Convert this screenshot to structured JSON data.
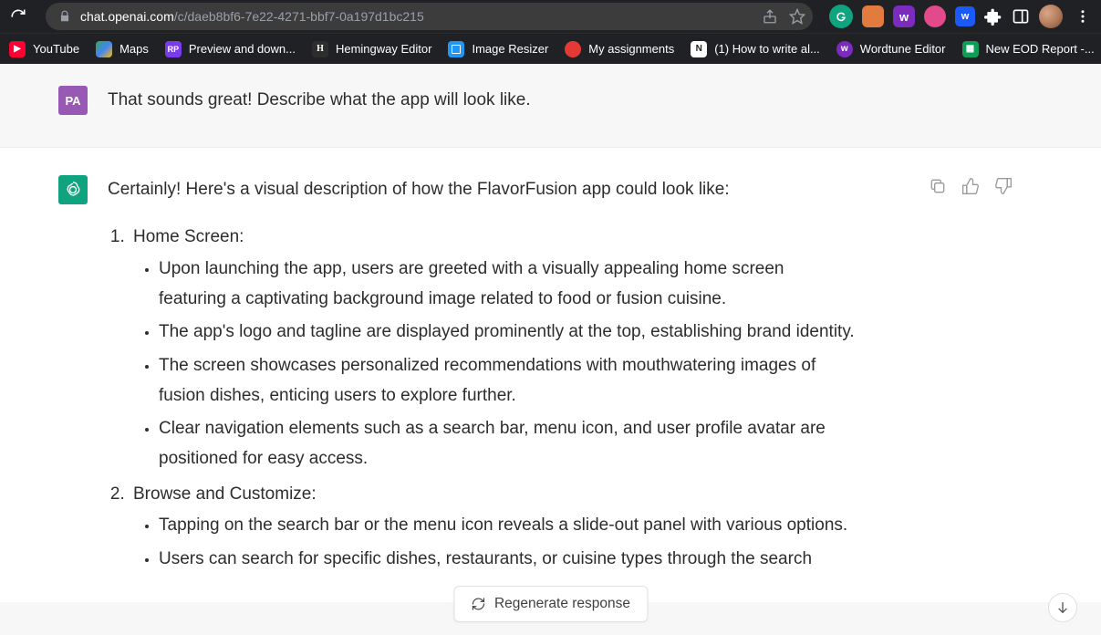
{
  "browser": {
    "url_host": "chat.openai.com",
    "url_path": "/c/daeb8bf6-7e22-4271-bbf7-0a197d1bc215"
  },
  "extensions": {
    "g": "",
    "w1": "w",
    "w2": "w"
  },
  "bookmarks": {
    "items": [
      {
        "label": "YouTube"
      },
      {
        "label": "Maps"
      },
      {
        "label": "Preview and down..."
      },
      {
        "label": "Hemingway Editor"
      },
      {
        "label": "Image Resizer"
      },
      {
        "label": "My assignments"
      },
      {
        "label": "(1) How to write al..."
      },
      {
        "label": "Wordtune Editor"
      },
      {
        "label": "New EOD Report -..."
      }
    ],
    "more": "»"
  },
  "chat": {
    "user_initials": "PA",
    "user_message": "That sounds great! Describe what the app will look like.",
    "ai_intro": "Certainly! Here's a visual description of how the FlavorFusion app could look like:",
    "sections": [
      {
        "title": "Home Screen:",
        "bullets": [
          "Upon launching the app, users are greeted with a visually appealing home screen featuring a captivating background image related to food or fusion cuisine.",
          "The app's logo and tagline are displayed prominently at the top, establishing brand identity.",
          "The screen showcases personalized recommendations with mouthwatering images of fusion dishes, enticing users to explore further.",
          "Clear navigation elements such as a search bar, menu icon, and user profile avatar are positioned for easy access."
        ]
      },
      {
        "title": "Browse and Customize:",
        "bullets": [
          "Tapping on the search bar or the menu icon reveals a slide-out panel with various options.",
          "Users can search for specific dishes, restaurants, or cuisine types through the search"
        ]
      }
    ]
  },
  "ui": {
    "regenerate": "Regenerate response"
  }
}
